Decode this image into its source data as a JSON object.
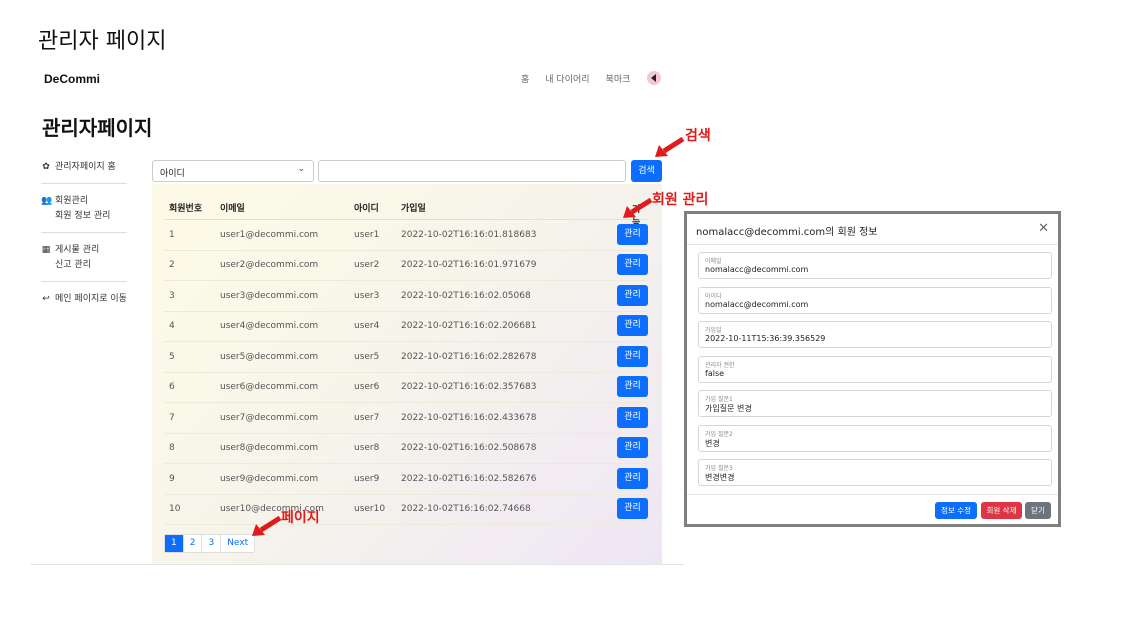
{
  "slide": {
    "title": "관리자 페이지"
  },
  "header": {
    "brand": "DeCommi",
    "nav": [
      "홈",
      "내 다이어리",
      "북마크"
    ]
  },
  "page": {
    "heading": "관리자페이지"
  },
  "sidebar": {
    "home": "관리자페이지 홈",
    "member_group": "회원관리",
    "member_info": "회원 정보 관리",
    "post_group": "게시물 관리",
    "report": "신고 관리",
    "back_main": "메인 페이지로 이동"
  },
  "search": {
    "select_value": "아이디",
    "input_value": "",
    "button_label": "검색"
  },
  "table": {
    "columns": [
      "회원번호",
      "이메일",
      "아이디",
      "가입일",
      "기능"
    ],
    "manage_label": "관리",
    "rows": [
      [
        "1",
        "user1@decommi.com",
        "user1",
        "2022-10-02T16:16:01.818683"
      ],
      [
        "2",
        "user2@decommi.com",
        "user2",
        "2022-10-02T16:16:01.971679"
      ],
      [
        "3",
        "user3@decommi.com",
        "user3",
        "2022-10-02T16:16:02.05068"
      ],
      [
        "4",
        "user4@decommi.com",
        "user4",
        "2022-10-02T16:16:02.206681"
      ],
      [
        "5",
        "user5@decommi.com",
        "user5",
        "2022-10-02T16:16:02.282678"
      ],
      [
        "6",
        "user6@decommi.com",
        "user6",
        "2022-10-02T16:16:02.357683"
      ],
      [
        "7",
        "user7@decommi.com",
        "user7",
        "2022-10-02T16:16:02.433678"
      ],
      [
        "8",
        "user8@decommi.com",
        "user8",
        "2022-10-02T16:16:02.508678"
      ],
      [
        "9",
        "user9@decommi.com",
        "user9",
        "2022-10-02T16:16:02.582676"
      ],
      [
        "10",
        "user10@decommi.com",
        "user10",
        "2022-10-02T16:16:02.74668"
      ]
    ]
  },
  "pagination": {
    "pages": [
      "1",
      "2",
      "3"
    ],
    "next": "Next",
    "active": "1"
  },
  "annotations": {
    "search": "검색",
    "member_manage": "회원 관리",
    "page": "페이지",
    "color": "#e01b1b"
  },
  "modal": {
    "title": "nomalacc@decommi.com의 회원 정보",
    "fields": [
      {
        "label": "이메일",
        "value": "nomalacc@decommi.com"
      },
      {
        "label": "아이디",
        "value": "nomalacc@decommi.com"
      },
      {
        "label": "가입일",
        "value": "2022-10-11T15:36:39.356529"
      },
      {
        "label": "관리자 권한",
        "value": "false"
      },
      {
        "label": "가입 질문1",
        "value": "가입질문 변경"
      },
      {
        "label": "가입 질문2",
        "value": "변경"
      },
      {
        "label": "가입 질문3",
        "value": "변경변경"
      }
    ],
    "buttons": {
      "edit": "정보 수정",
      "delete": "회원 삭제",
      "close": "닫기"
    }
  },
  "colors": {
    "primary": "#0d6efd",
    "danger": "#dc3545",
    "secondary": "#6c757d"
  }
}
